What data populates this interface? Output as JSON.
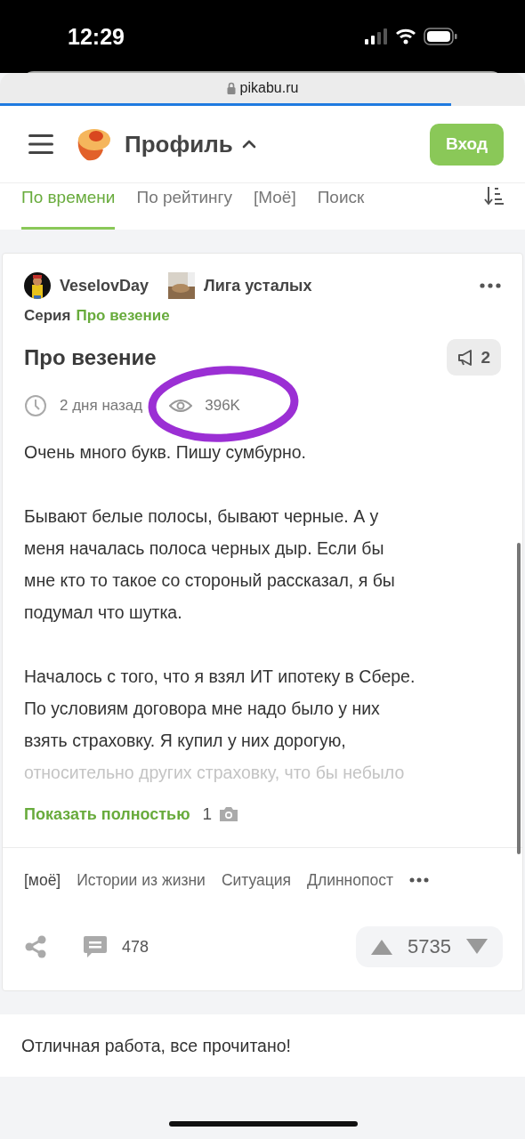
{
  "status_bar": {
    "time": "12:29"
  },
  "browser": {
    "url": "pikabu.ru",
    "progress": {
      "level": 0.86
    }
  },
  "header": {
    "title": "Профиль",
    "login_button": "Вход"
  },
  "tabs": [
    {
      "label": "По времени",
      "selected": true
    },
    {
      "label": "По рейтингу",
      "selected": false
    },
    {
      "label": "[Моё]",
      "selected": false
    },
    {
      "label": "Поиск",
      "selected": false
    }
  ],
  "post": {
    "author": "VeselovDay",
    "community": "Лига усталых",
    "series_label": "Серия",
    "series_link": "Про везение",
    "title": "Про везение",
    "badge_count": "2",
    "time": "2 дня назад",
    "views": "396K",
    "paragraphs": [
      [
        "Очень много букв. Пишу сумбурно."
      ],
      [
        "Бывают белые полосы, бывают черные. А у",
        "меня началась полоса черных дыр. Если бы",
        "мне кто то такое со стороный рассказал, я бы",
        "подумал что шутка."
      ],
      [
        "Началось с того, что я взял ИТ ипотеку в Сбере.",
        "По условиям договора мне надо было у них",
        "взять страховку. Я купил у них дорогую,",
        "относительно других страховку, что бы небыло"
      ]
    ],
    "show_more": "Показать полностью",
    "photo_count": "1",
    "tags": [
      "[моё]",
      "Истории из жизни",
      "Ситуация",
      "Длиннопост"
    ],
    "comments": "478",
    "rating": "5735"
  },
  "footer_message": "Отличная работа, все прочитано!"
}
